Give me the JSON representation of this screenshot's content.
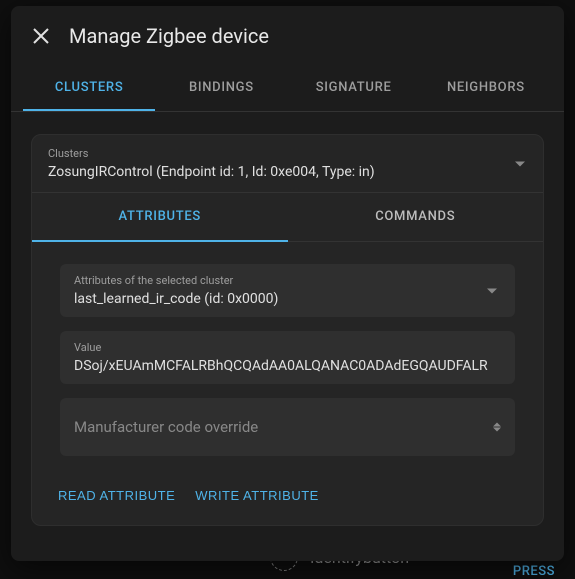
{
  "header": {
    "title": "Manage Zigbee device"
  },
  "tabs": [
    {
      "id": "clusters",
      "label": "CLUSTERS",
      "active": true
    },
    {
      "id": "bindings",
      "label": "BINDINGS",
      "active": false
    },
    {
      "id": "signature",
      "label": "SIGNATURE",
      "active": false
    },
    {
      "id": "neighbors",
      "label": "NEIGHBORS",
      "active": false
    }
  ],
  "clusterSelect": {
    "label": "Clusters",
    "value": "ZosungIRControl (Endpoint id: 1, Id: 0xe004, Type: in)"
  },
  "subTabs": [
    {
      "id": "attributes",
      "label": "ATTRIBUTES",
      "active": true
    },
    {
      "id": "commands",
      "label": "COMMANDS",
      "active": false
    }
  ],
  "attributeSelect": {
    "label": "Attributes of the selected cluster",
    "value": "last_learned_ir_code (id: 0x0000)"
  },
  "valueField": {
    "label": "Value",
    "value": "DSoj/xEUAmMCFALRBhQCQAdAA0ALQANAC0ADAdEGQAUDFALR"
  },
  "manufacturerField": {
    "placeholder": "Manufacturer code override"
  },
  "actions": {
    "read": "READ ATTRIBUTE",
    "write": "WRITE ATTRIBUTE"
  },
  "backdrop": {
    "entityLabel": "Identifybutton",
    "pressLabel": "PRESS"
  }
}
